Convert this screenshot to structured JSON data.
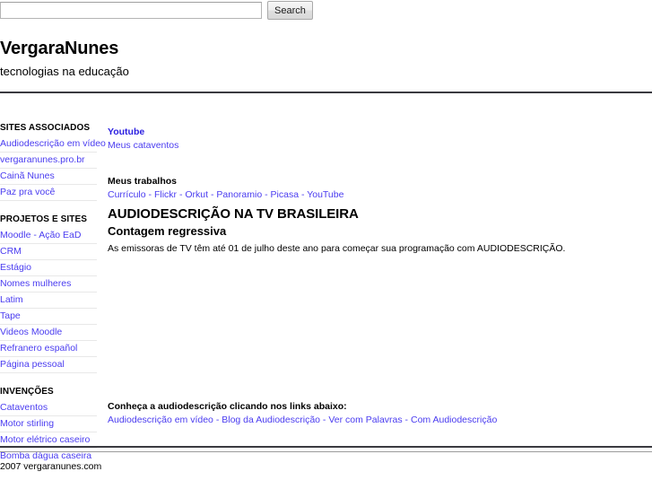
{
  "search": {
    "value": "",
    "placeholder": "",
    "button_label": "Search"
  },
  "masthead": {
    "title": "VergaraNunes",
    "tagline": "tecnologias na educação"
  },
  "sidebar": {
    "groups": [
      {
        "heading": "SITES ASSOCIADOS",
        "items": [
          "Audiodescrição em vídeo",
          "vergaranunes.pro.br",
          "Cainã Nunes",
          "Paz pra você"
        ]
      },
      {
        "heading": "PROJETOS E SITES",
        "items": [
          "Moodle - Ação EaD",
          "CRM",
          "Estágio",
          "Nomes mulheres",
          "Latim",
          "Tape",
          "Videos Moodle",
          "Refranero español",
          "Página pessoal"
        ]
      },
      {
        "heading": "INVENÇÕES",
        "items": [
          "Cataventos",
          "Motor stirling",
          "Motor elétrico caseiro",
          "Bomba dágua caseira"
        ]
      }
    ]
  },
  "main": {
    "youtube": {
      "heading": "Youtube",
      "sub_link": "Meus cataventos"
    },
    "works": {
      "label": "Meus trabalhos",
      "links": [
        "Currículo",
        "Flickr",
        "Orkut",
        "Panoramio",
        "Picasa",
        "YouTube"
      ],
      "separator": " - "
    },
    "article": {
      "title": "AUDIODESCRIÇÃO NA TV BRASILEIRA",
      "subtitle": "Contagem regressiva",
      "body": "As emissoras de TV têm até 01 de julho deste ano para começar sua programação com AUDIODESCRIÇÃO."
    },
    "bottom": {
      "label": "Conheça a audiodescrição clicando nos links abaixo:",
      "links": [
        "Audiodescrição em vídeo",
        "Blog da Audiodescrição",
        "Ver com Palavras",
        "Com Audiodescrição"
      ],
      "separator": " - "
    }
  },
  "footer": {
    "copyright": "2007 vergaranunes.com"
  },
  "colors": {
    "link": "#4a3cf0",
    "link_bold": "#2a1ee0",
    "rule_dark": "#3a3a40",
    "rule_light": "#9b9b9b",
    "divider": "#e8e8e8"
  }
}
